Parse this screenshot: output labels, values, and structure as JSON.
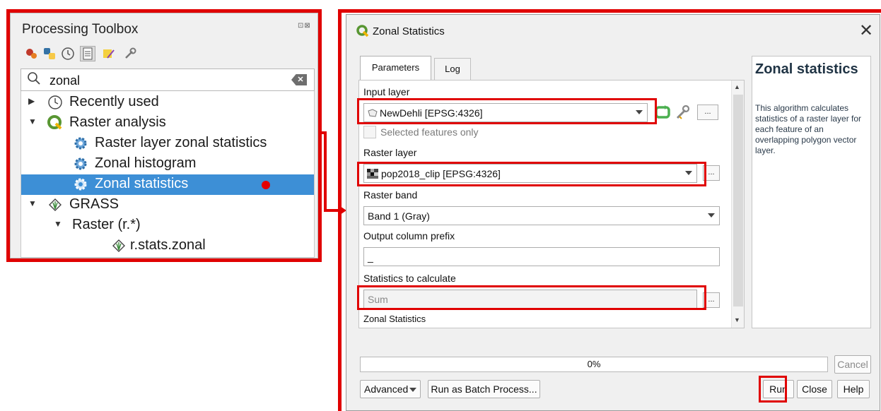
{
  "toolbox": {
    "title": "Processing Toolbox",
    "float_glyphs": "⊡⊠",
    "search": {
      "value": "zonal",
      "clear_icon": "backspace-icon"
    },
    "tree": [
      {
        "label": "Recently used",
        "icon": "clock-icon",
        "expanded": false
      },
      {
        "label": "Raster analysis",
        "icon": "qgis-icon",
        "expanded": true
      },
      {
        "label": "Raster layer zonal statistics",
        "icon": "gear-icon"
      },
      {
        "label": "Zonal histogram",
        "icon": "gear-icon"
      },
      {
        "label": "Zonal statistics",
        "icon": "gear-icon",
        "selected": true
      },
      {
        "label": "GRASS",
        "icon": "grass-icon",
        "expanded": true
      },
      {
        "label": "Raster (r.*)",
        "expanded": true
      },
      {
        "label": "r.stats.zonal",
        "icon": "grass-icon"
      }
    ]
  },
  "dialog": {
    "title": "Zonal Statistics",
    "close_glyph": "✕",
    "tabs": {
      "parameters": "Parameters",
      "log": "Log"
    },
    "input_layer": {
      "label": "Input layer",
      "value": "NewDehli [EPSG:4326]"
    },
    "selected_only": {
      "label": "Selected features only",
      "checked": false
    },
    "raster_layer": {
      "label": "Raster layer",
      "value": "pop2018_clip [EPSG:4326]"
    },
    "raster_band": {
      "label": "Raster band",
      "value": "Band 1 (Gray)"
    },
    "output_prefix": {
      "label": "Output column prefix",
      "value": "_"
    },
    "statistics": {
      "label": "Statistics to calculate",
      "value": "Sum"
    },
    "section_footer": "Zonal Statistics",
    "dots": "...",
    "help": {
      "title": "Zonal statistics",
      "text": "This algorithm calculates statistics of a raster layer for each feature of an overlapping polygon vector layer."
    },
    "progress": {
      "label": "0%",
      "value": 0
    },
    "buttons": {
      "cancel": "Cancel",
      "advanced": "Advanced",
      "batch": "Run as Batch Process...",
      "run": "Run",
      "close": "Close",
      "help": "Help"
    }
  },
  "colors": {
    "highlight": "#e00000",
    "selection": "#3d8fd6",
    "qgis_green": "#589632"
  }
}
